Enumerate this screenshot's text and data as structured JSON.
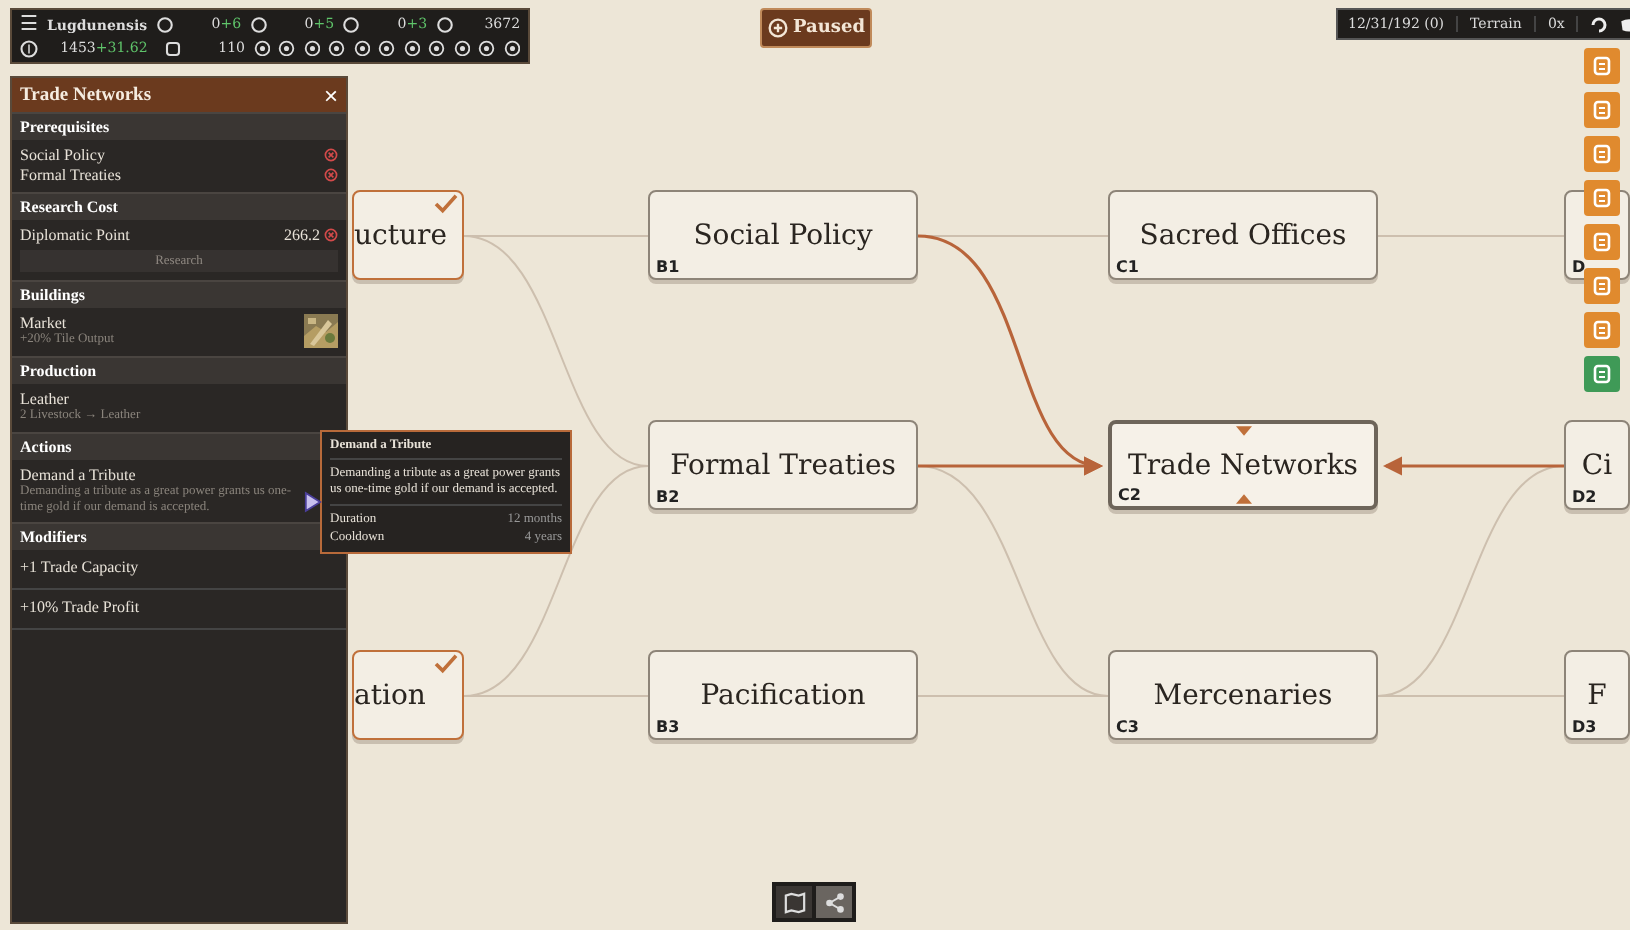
{
  "topbar": {
    "menu_icon": "☰",
    "city": "Lugdunensis",
    "row1": [
      {
        "value": "0",
        "delta": "+6"
      },
      {
        "value": "0",
        "delta": "+5"
      },
      {
        "value": "0",
        "delta": "+3"
      },
      {
        "value": "3672"
      }
    ],
    "treasury": {
      "value": "1453",
      "delta": "+31.62"
    },
    "row2_value": "110"
  },
  "game_state": {
    "label": "Paused"
  },
  "status_bar": {
    "date": "12/31/192 (0)",
    "mode": "Terrain",
    "speed": "0x"
  },
  "side_buttons": [
    {
      "color": "#e08a2e"
    },
    {
      "color": "#e08a2e"
    },
    {
      "color": "#e08a2e"
    },
    {
      "color": "#e08a2e"
    },
    {
      "color": "#e08a2e"
    },
    {
      "color": "#e08a2e"
    },
    {
      "color": "#e08a2e"
    },
    {
      "color": "#3f9a57"
    }
  ],
  "nodes": [
    {
      "label": "ucture",
      "researched": true,
      "selected": false
    },
    {
      "label": "ation",
      "researched": true,
      "selected": false
    },
    {
      "label": "Social Policy",
      "code": "B1",
      "researched": false,
      "selected": false
    },
    {
      "label": "Formal Treaties",
      "code": "B2",
      "researched": false,
      "selected": false
    },
    {
      "label": "Pacification",
      "code": "B3",
      "researched": false,
      "selected": false
    },
    {
      "label": "Sacred Offices",
      "code": "C1",
      "researched": false,
      "selected": false
    },
    {
      "label": "Trade Networks",
      "code": "C2",
      "researched": false,
      "selected": true
    },
    {
      "label": "Mercenaries",
      "code": "C3",
      "researched": false,
      "selected": false
    },
    {
      "code": "D",
      "researched": false,
      "selected": false
    },
    {
      "label": "Ci",
      "code": "D2",
      "researched": false,
      "selected": false
    },
    {
      "label": "F",
      "code": "D3",
      "researched": false,
      "selected": false
    }
  ],
  "panel": {
    "title": "Trade Networks",
    "close": "×",
    "prerequisites": {
      "heading": "Prerequisites",
      "items": [
        {
          "name": "Social Policy",
          "met": false
        },
        {
          "name": "Formal Treaties",
          "met": false
        }
      ]
    },
    "research_cost": {
      "heading": "Research Cost",
      "resource": "Diplomatic Point",
      "amount": "266.2",
      "affordable": false,
      "button": {
        "label": "Research",
        "disabled": true
      }
    },
    "buildings": {
      "heading": "Buildings",
      "items": [
        {
          "name": "Market",
          "effect": "+20% Tile Output"
        }
      ]
    },
    "production": {
      "heading": "Production",
      "items": [
        {
          "name": "Leather",
          "recipe": "2 Livestock → Leather"
        }
      ]
    },
    "actions": {
      "heading": "Actions",
      "items": [
        {
          "name": "Demand a Tribute",
          "description": "Demanding a tribute as a great power grants us one-time gold if our demand is accepted."
        }
      ]
    },
    "modifiers": {
      "heading": "Modifiers",
      "items": [
        "+1 Trade Capacity",
        "+10% Trade Profit"
      ]
    }
  },
  "tooltip": {
    "title": "Demand a Tribute",
    "description": "Demanding a tribute as a great power grants us one-time gold if our demand is accepted.",
    "rows": [
      {
        "label": "Duration",
        "value": "12 months"
      },
      {
        "label": "Cooldown",
        "value": "4 years"
      }
    ]
  },
  "view_toggle": [
    {
      "selected": false
    },
    {
      "selected": true
    }
  ]
}
